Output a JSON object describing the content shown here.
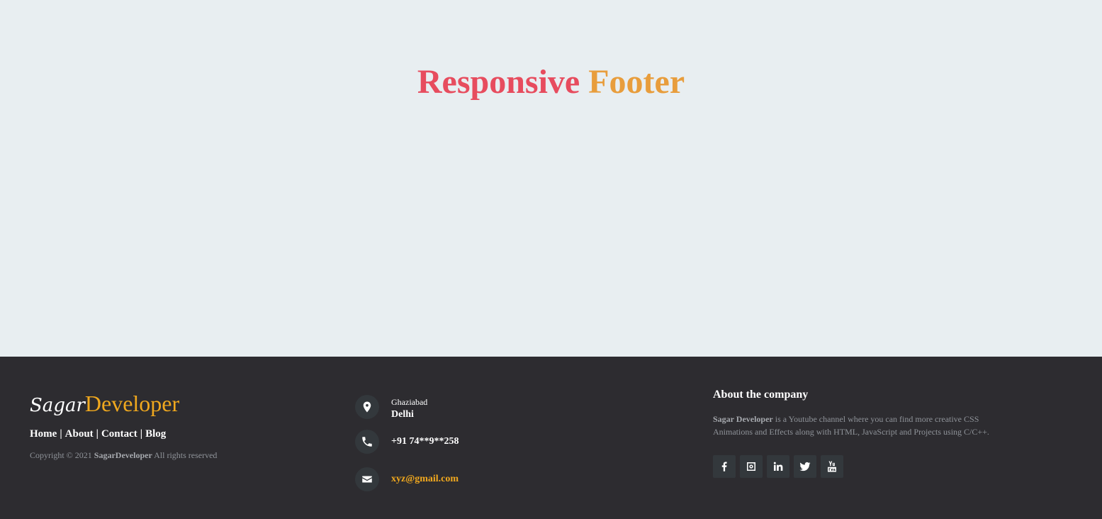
{
  "hero": {
    "title_word1": "Responsive",
    "title_word2": "Footer"
  },
  "footer": {
    "logo": {
      "part1": "Sagar",
      "part2": "Developer"
    },
    "nav": [
      {
        "label": "Home"
      },
      {
        "label": "About"
      },
      {
        "label": "Contact"
      },
      {
        "label": "Blog"
      }
    ],
    "nav_separator": "|",
    "copyright": {
      "prefix": "Copyright © 2021",
      "brand": "SagarDeveloper",
      "suffix": "All rights reserved"
    },
    "contact": {
      "location_line1": "Ghaziabad",
      "location_line2": "Delhi",
      "phone": "+91 74**9**258",
      "email": "xyz@gmail.com"
    },
    "about": {
      "title": "About the company",
      "brand": "Sagar Developer",
      "text": "is a Youtube channel where you can find more creative CSS Animations and Effects along with HTML, JavaScript and Projects using C/C++."
    },
    "socials": [
      "facebook-icon",
      "instagram-icon",
      "linkedin-icon",
      "twitter-icon",
      "youtube-icon"
    ]
  },
  "colors": {
    "background": "#e8eef1",
    "footer_bg": "#2d2c30",
    "accent_red": "#e74c5e",
    "accent_orange": "#e89d3c",
    "accent_yellow": "#f0a81e",
    "icon_bg": "#33383c"
  }
}
